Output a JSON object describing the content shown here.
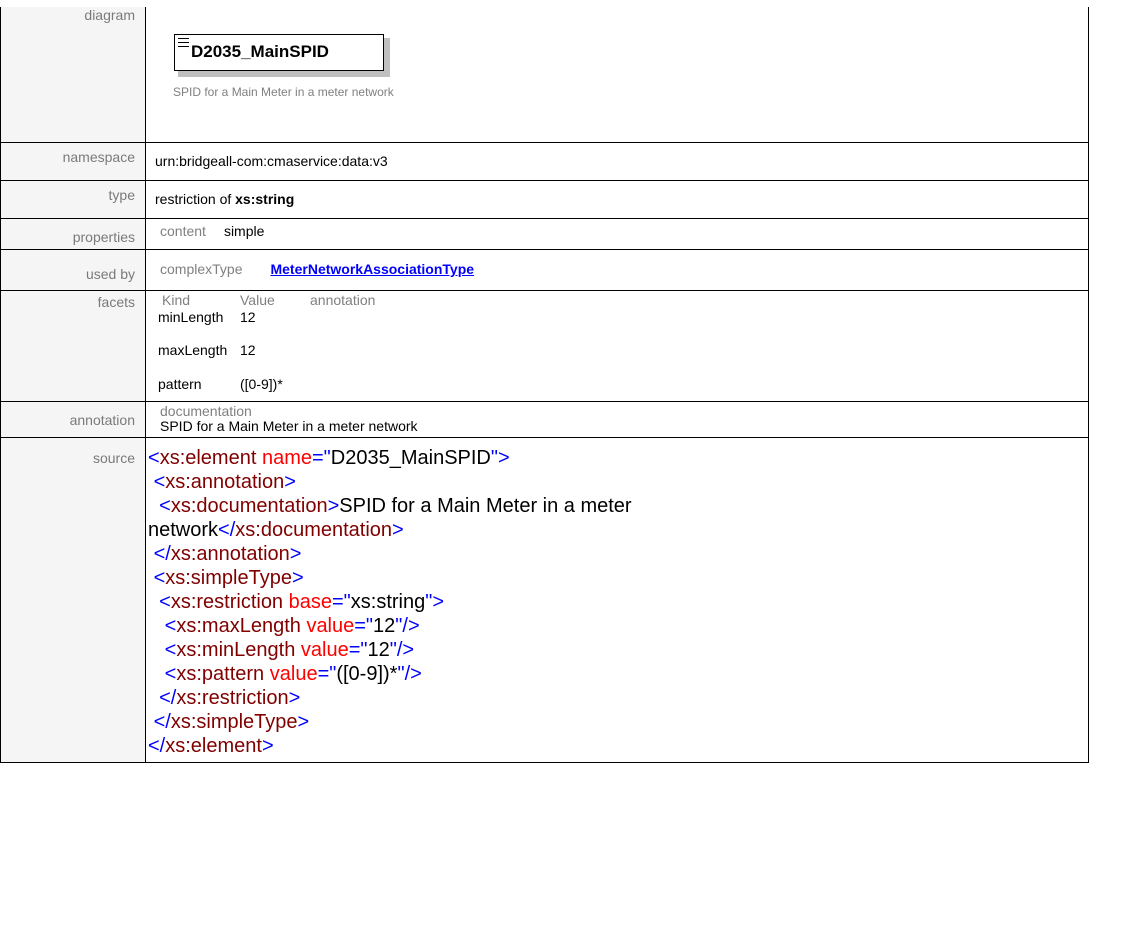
{
  "labels": {
    "diagram": "diagram",
    "namespace": "namespace",
    "type": "type",
    "properties": "properties",
    "used_by": "used by",
    "facets": "facets",
    "annotation": "annotation",
    "source": "source"
  },
  "diagram": {
    "element_name": "D2035_MainSPID",
    "description": "SPID for a Main Meter in a meter network"
  },
  "namespace": "urn:bridgeall-com:cmaservice:data:v3",
  "type": {
    "prefix": "restriction of ",
    "base": "xs:string"
  },
  "properties": {
    "key": "content",
    "value": "simple"
  },
  "used_by": {
    "key": "complexType",
    "link": "MeterNetworkAssociationType"
  },
  "facets": {
    "headers": [
      "Kind",
      "Value",
      "annotation"
    ],
    "rows": [
      {
        "kind": "minLength",
        "value": "12"
      },
      {
        "kind": "maxLength",
        "value": "12"
      },
      {
        "kind": "pattern",
        "value": "([0-9])*"
      }
    ]
  },
  "annotation": {
    "key": "documentation",
    "text": "SPID for a Main Meter in a meter network"
  },
  "source": {
    "element_name": "D2035_MainSPID",
    "documentation_line1": "SPID for a Main Meter in a meter",
    "documentation_line2": "network",
    "restriction_base": "xs:string",
    "max_length": "12",
    "min_length": "12",
    "pattern": "([0-9])*"
  },
  "colors": {
    "tag": "#0000ff",
    "element": "#800000",
    "attribute": "#ff0000",
    "link": "#0000ff",
    "label_gray": "#808080"
  }
}
